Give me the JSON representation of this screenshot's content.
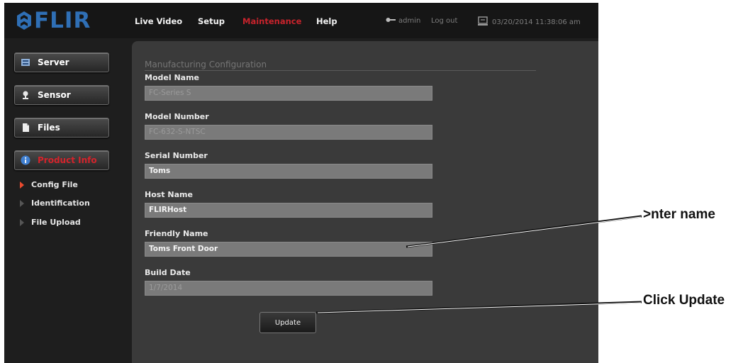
{
  "header": {
    "logo_text": "FLIR",
    "nav": [
      {
        "label": "Live Video",
        "active": false
      },
      {
        "label": "Setup",
        "active": false
      },
      {
        "label": "Maintenance",
        "active": true
      },
      {
        "label": "Help",
        "active": false
      }
    ],
    "user": "admin",
    "logout_label": "Log out",
    "datetime": "03/20/2014 11:38:06 am"
  },
  "sidebar": {
    "buttons": [
      {
        "label": "Server",
        "icon": "server-icon"
      },
      {
        "label": "Sensor",
        "icon": "sensor-icon"
      },
      {
        "label": "Files",
        "icon": "file-icon"
      },
      {
        "label": "Product Info",
        "icon": "info-icon",
        "active": true
      }
    ],
    "subitems": [
      {
        "label": "Config File",
        "active": true
      },
      {
        "label": "Identification",
        "active": false
      },
      {
        "label": "File Upload",
        "active": false
      }
    ]
  },
  "main": {
    "section_title": "Manufacturing Configuration",
    "fields": [
      {
        "label": "Model Name",
        "value": "FC-Series S",
        "readonly": true
      },
      {
        "label": "Model Number",
        "value": "FC-632-S-NTSC",
        "readonly": true
      },
      {
        "label": "Serial Number",
        "value": "Toms",
        "readonly": false
      },
      {
        "label": "Host Name",
        "value": "FLIRHost",
        "readonly": false
      },
      {
        "label": "Friendly Name",
        "value": "Toms Front Door",
        "readonly": false
      },
      {
        "label": "Build Date",
        "value": "1/7/2014",
        "readonly": true
      }
    ],
    "update_label": "Update"
  },
  "annotations": {
    "enter_name": ">nter name",
    "click_update": "Click Update"
  },
  "colors": {
    "accent_red": "#c8232c",
    "logo_blue": "#2f6fb5",
    "panel": "#3a3a3a"
  }
}
